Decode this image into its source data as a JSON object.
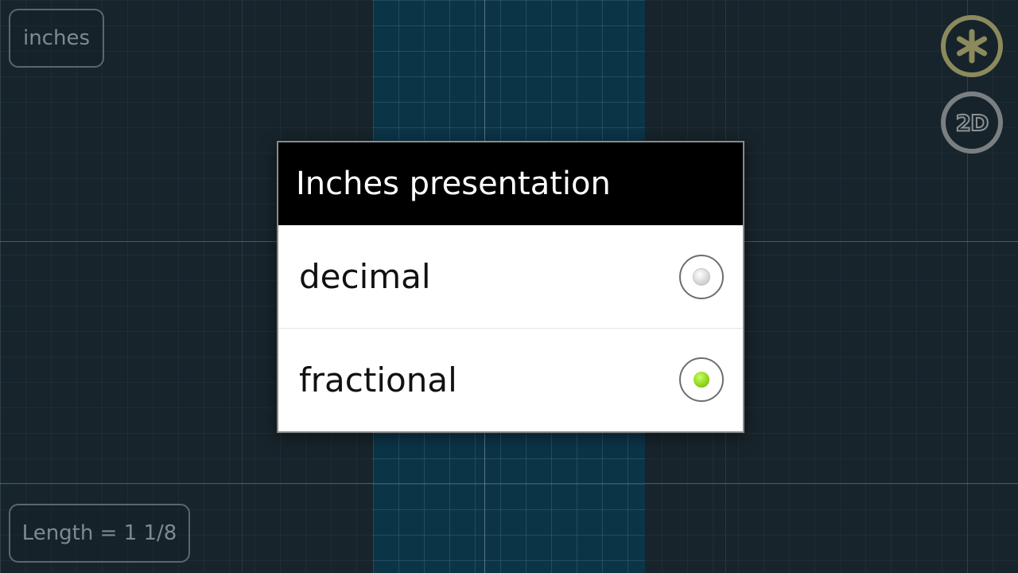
{
  "toolbar": {
    "unit_label": "inches",
    "length_readout": "Length = 1 1/8",
    "mode_2d_label": "2D"
  },
  "icons": {
    "settings": "asterisk-icon",
    "mode": "2d-icon"
  },
  "dialog": {
    "title": "Inches presentation",
    "options": [
      {
        "label": "decimal",
        "selected": false
      },
      {
        "label": "fractional",
        "selected": true
      }
    ]
  },
  "colors": {
    "accent_green": "#8ed21a",
    "band_blue": "#0c3447",
    "background": "#17242b",
    "asterisk_yellow": "#8c8a5c"
  }
}
